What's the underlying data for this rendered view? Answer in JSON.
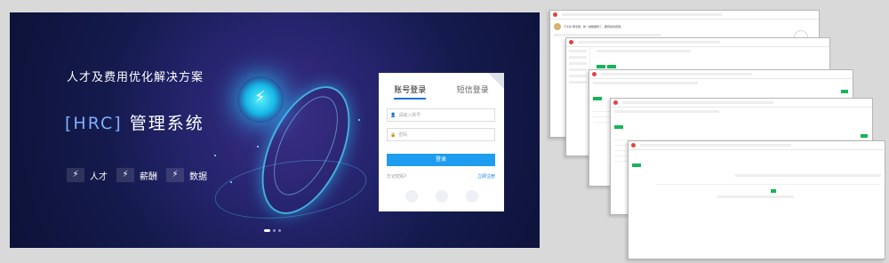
{
  "hero": {
    "title": "人才及费用优化解决方案",
    "bracket_left": "[HRC]",
    "system_name": "管理系统",
    "tags": [
      "人才",
      "薪酬",
      "数据"
    ],
    "bolt_icon": "⚡"
  },
  "login": {
    "tabs": [
      "账号登录",
      "短信登录"
    ],
    "username_placeholder": "请输入账号",
    "password_placeholder": "密码",
    "submit_label": "登录",
    "forgot_label": "忘记密码?",
    "register_label": "立即注册"
  },
  "colors": {
    "accent": "#1e9cf0",
    "tab_active": "#1f6fe5",
    "window_button": "#18b45a"
  },
  "windows": {
    "greeting": "下午好 李北辰，新一批数据到了，期待您的查阅。"
  }
}
